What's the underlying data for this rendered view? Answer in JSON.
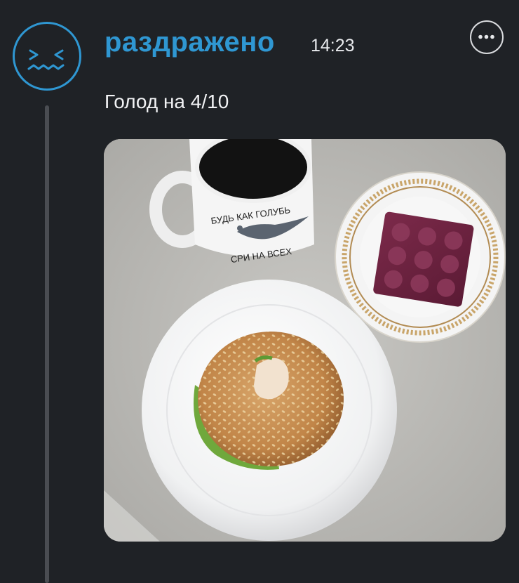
{
  "post": {
    "author": "раздражено",
    "time": "14:23",
    "text": "Голод на 4/10"
  },
  "avatar": {
    "icon": "grimace-face-icon",
    "color": "#2f97d2"
  },
  "more_button": {
    "icon": "ellipsis-icon"
  },
  "photo": {
    "mug_text_top": "БУДЬ КАК ГОЛУБЬ",
    "mug_text_bottom": "СРИ НА ВСЕХ"
  },
  "colors": {
    "background": "#1f2226",
    "accent": "#2f97d2",
    "thread_line": "#4a4d52"
  }
}
